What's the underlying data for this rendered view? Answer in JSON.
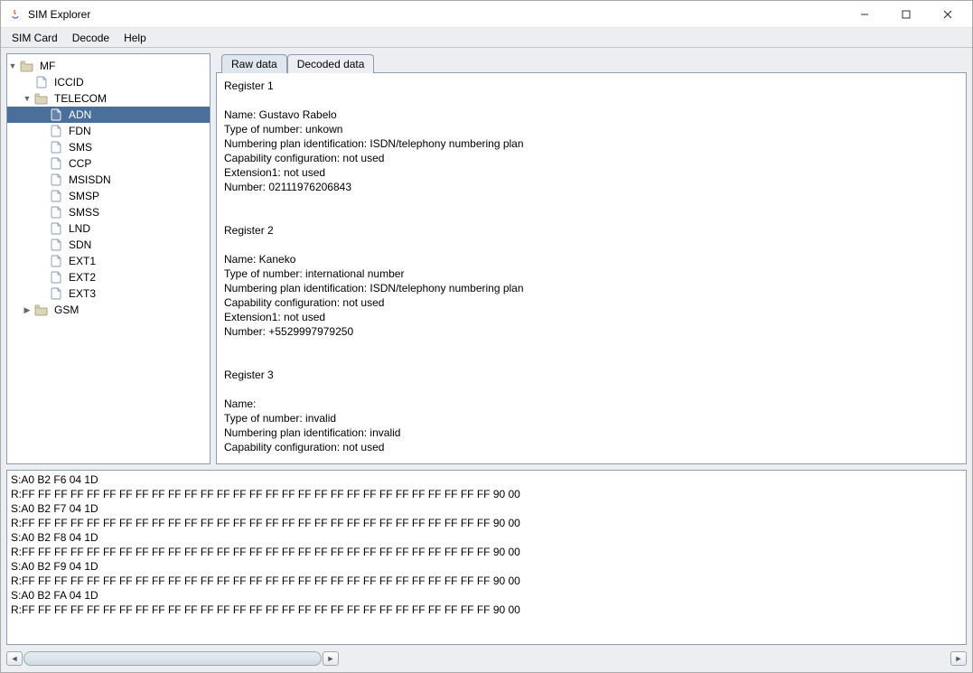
{
  "window": {
    "title": "SIM Explorer"
  },
  "menu": {
    "items": [
      "SIM Card",
      "Decode",
      "Help"
    ]
  },
  "tree": {
    "nodes": [
      {
        "depth": 0,
        "expander": "▼",
        "icon": "folder",
        "label": "MF",
        "selected": false
      },
      {
        "depth": 1,
        "expander": "",
        "icon": "file",
        "label": "ICCID",
        "selected": false
      },
      {
        "depth": 1,
        "expander": "▼",
        "icon": "folder",
        "label": "TELECOM",
        "selected": false
      },
      {
        "depth": 2,
        "expander": "",
        "icon": "file",
        "label": "ADN",
        "selected": true
      },
      {
        "depth": 2,
        "expander": "",
        "icon": "file",
        "label": "FDN",
        "selected": false
      },
      {
        "depth": 2,
        "expander": "",
        "icon": "file",
        "label": "SMS",
        "selected": false
      },
      {
        "depth": 2,
        "expander": "",
        "icon": "file",
        "label": "CCP",
        "selected": false
      },
      {
        "depth": 2,
        "expander": "",
        "icon": "file",
        "label": "MSISDN",
        "selected": false
      },
      {
        "depth": 2,
        "expander": "",
        "icon": "file",
        "label": "SMSP",
        "selected": false
      },
      {
        "depth": 2,
        "expander": "",
        "icon": "file",
        "label": "SMSS",
        "selected": false
      },
      {
        "depth": 2,
        "expander": "",
        "icon": "file",
        "label": "LND",
        "selected": false
      },
      {
        "depth": 2,
        "expander": "",
        "icon": "file",
        "label": "SDN",
        "selected": false
      },
      {
        "depth": 2,
        "expander": "",
        "icon": "file",
        "label": "EXT1",
        "selected": false
      },
      {
        "depth": 2,
        "expander": "",
        "icon": "file",
        "label": "EXT2",
        "selected": false
      },
      {
        "depth": 2,
        "expander": "",
        "icon": "file",
        "label": "EXT3",
        "selected": false
      },
      {
        "depth": 1,
        "expander": "▶",
        "icon": "folder",
        "label": "GSM",
        "selected": false
      }
    ]
  },
  "tabs": {
    "raw": "Raw data",
    "decoded": "Decoded data",
    "active": "decoded"
  },
  "decoded": {
    "text": "Register 1\n\nName: Gustavo Rabelo\nType of number: unkown\nNumbering plan identification: ISDN/telephony numbering plan\nCapability configuration: not used\nExtension1: not used\nNumber: 02111976206843\n\n\nRegister 2\n\nName: Kaneko\nType of number: international number\nNumbering plan identification: ISDN/telephony numbering plan\nCapability configuration: not used\nExtension1: not used\nNumber: +5529997979250\n\n\nRegister 3\n\nName:\nType of number: invalid\nNumbering plan identification: invalid\nCapability configuration: not used"
  },
  "log": {
    "lines": [
      "S:A0 B2 F6 04 1D",
      "R:FF FF FF FF FF FF FF FF FF FF FF FF FF FF FF FF FF FF FF FF FF FF FF FF FF FF FF FF FF 90 00",
      "S:A0 B2 F7 04 1D",
      "R:FF FF FF FF FF FF FF FF FF FF FF FF FF FF FF FF FF FF FF FF FF FF FF FF FF FF FF FF FF 90 00",
      "S:A0 B2 F8 04 1D",
      "R:FF FF FF FF FF FF FF FF FF FF FF FF FF FF FF FF FF FF FF FF FF FF FF FF FF FF FF FF FF 90 00",
      "S:A0 B2 F9 04 1D",
      "R:FF FF FF FF FF FF FF FF FF FF FF FF FF FF FF FF FF FF FF FF FF FF FF FF FF FF FF FF FF 90 00",
      "S:A0 B2 FA 04 1D",
      "R:FF FF FF FF FF FF FF FF FF FF FF FF FF FF FF FF FF FF FF FF FF FF FF FF FF FF FF FF FF 90 00"
    ]
  }
}
